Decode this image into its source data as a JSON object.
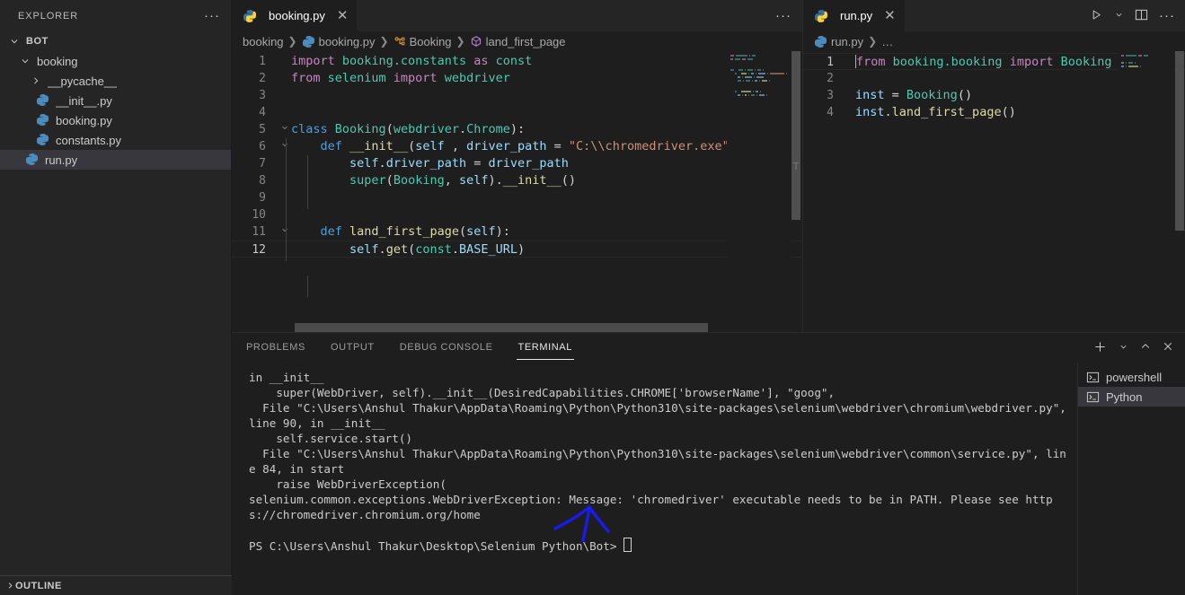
{
  "sidebar": {
    "title": "EXPLORER",
    "more_label": "···",
    "tree": [
      {
        "label": "BOT",
        "type": "folder-root",
        "expanded": true,
        "indent": 0
      },
      {
        "label": "booking",
        "type": "folder",
        "expanded": true,
        "indent": 1
      },
      {
        "label": "__pycache__",
        "type": "folder",
        "expanded": false,
        "indent": 2
      },
      {
        "label": "__init__.py",
        "type": "python",
        "indent": 2
      },
      {
        "label": "booking.py",
        "type": "python",
        "indent": 2
      },
      {
        "label": "constants.py",
        "type": "python",
        "indent": 2
      },
      {
        "label": "run.py",
        "type": "python",
        "indent": 1,
        "selected": true
      }
    ],
    "outline_label": "OUTLINE"
  },
  "editor_left": {
    "tab": {
      "title": "booking.py",
      "icon": "python-icon",
      "close": "✕"
    },
    "actions": {
      "more": "···"
    },
    "breadcrumbs": [
      {
        "label": "booking",
        "icon": "none"
      },
      {
        "label": "booking.py",
        "icon": "python-icon"
      },
      {
        "label": "Booking",
        "icon": "class-icon"
      },
      {
        "label": "land_first_page",
        "icon": "method-icon"
      }
    ],
    "separator": "❯",
    "lines": [
      {
        "n": "1",
        "tokens": [
          {
            "t": "import",
            "c": "k"
          },
          {
            "t": " booking.constants ",
            "c": "cls"
          },
          {
            "t": "as",
            "c": "k"
          },
          {
            "t": " const",
            "c": "cls"
          }
        ]
      },
      {
        "n": "2",
        "tokens": [
          {
            "t": "from",
            "c": "k"
          },
          {
            "t": " selenium ",
            "c": "cls"
          },
          {
            "t": "import",
            "c": "k"
          },
          {
            "t": " webdriver",
            "c": "cls"
          }
        ]
      },
      {
        "n": "3",
        "tokens": []
      },
      {
        "n": "4",
        "tokens": []
      },
      {
        "n": "5",
        "fold": true,
        "tokens": [
          {
            "t": "class",
            "c": "kd"
          },
          {
            "t": " ",
            "c": "pl"
          },
          {
            "t": "Booking",
            "c": "cls"
          },
          {
            "t": "(",
            "c": "pl"
          },
          {
            "t": "webdriver",
            "c": "cls"
          },
          {
            "t": ".",
            "c": "pl"
          },
          {
            "t": "Chrome",
            "c": "cls"
          },
          {
            "t": "):",
            "c": "pl"
          }
        ]
      },
      {
        "n": "6",
        "fold": true,
        "tokens": [
          {
            "t": "    ",
            "c": "pl"
          },
          {
            "t": "def",
            "c": "kd"
          },
          {
            "t": " ",
            "c": "pl"
          },
          {
            "t": "__init__",
            "c": "fn"
          },
          {
            "t": "(",
            "c": "pl"
          },
          {
            "t": "self",
            "c": "var"
          },
          {
            "t": " , ",
            "c": "pl"
          },
          {
            "t": "driver_path",
            "c": "var"
          },
          {
            "t": " = ",
            "c": "pl"
          },
          {
            "t": "\"C:\\\\chromedriver.exe\"",
            "c": "str"
          },
          {
            "t": "):",
            "c": "pl"
          }
        ]
      },
      {
        "n": "7",
        "tokens": [
          {
            "t": "        ",
            "c": "pl"
          },
          {
            "t": "self",
            "c": "var"
          },
          {
            "t": ".",
            "c": "pl"
          },
          {
            "t": "driver_path",
            "c": "var"
          },
          {
            "t": " = ",
            "c": "pl"
          },
          {
            "t": "driver_path",
            "c": "var"
          }
        ]
      },
      {
        "n": "8",
        "tokens": [
          {
            "t": "        ",
            "c": "pl"
          },
          {
            "t": "super",
            "c": "cls"
          },
          {
            "t": "(",
            "c": "pl"
          },
          {
            "t": "Booking",
            "c": "cls"
          },
          {
            "t": ", ",
            "c": "pl"
          },
          {
            "t": "self",
            "c": "var"
          },
          {
            "t": ").",
            "c": "pl"
          },
          {
            "t": "__init__",
            "c": "fn"
          },
          {
            "t": "()",
            "c": "pl"
          }
        ]
      },
      {
        "n": "9",
        "tokens": []
      },
      {
        "n": "10",
        "tokens": []
      },
      {
        "n": "11",
        "fold": true,
        "tokens": [
          {
            "t": "    ",
            "c": "pl"
          },
          {
            "t": "def",
            "c": "kd"
          },
          {
            "t": " ",
            "c": "pl"
          },
          {
            "t": "land_first_page",
            "c": "fn"
          },
          {
            "t": "(",
            "c": "pl"
          },
          {
            "t": "self",
            "c": "var"
          },
          {
            "t": "):",
            "c": "pl"
          }
        ]
      },
      {
        "n": "12",
        "current": true,
        "tokens": [
          {
            "t": "        ",
            "c": "pl"
          },
          {
            "t": "self",
            "c": "var"
          },
          {
            "t": ".",
            "c": "pl"
          },
          {
            "t": "get",
            "c": "fn"
          },
          {
            "t": "(",
            "c": "pl"
          },
          {
            "t": "const",
            "c": "cls"
          },
          {
            "t": ".",
            "c": "pl"
          },
          {
            "t": "BASE_URL",
            "c": "var"
          },
          {
            "t": ")",
            "c": "pl"
          }
        ]
      }
    ]
  },
  "editor_right": {
    "tab": {
      "title": "run.py",
      "icon": "python-icon",
      "close": "✕"
    },
    "actions": {
      "run": "run-icon",
      "run_chevron": "chevron-down-icon",
      "split": "split-editor-icon",
      "more": "···"
    },
    "breadcrumbs": [
      {
        "label": "run.py",
        "icon": "python-icon"
      },
      {
        "label": "…",
        "icon": "none"
      }
    ],
    "separator": "❯",
    "lines": [
      {
        "n": "1",
        "current": true,
        "tokens": [
          {
            "t": "from",
            "c": "k"
          },
          {
            "t": " booking.booking ",
            "c": "cls"
          },
          {
            "t": "import",
            "c": "k"
          },
          {
            "t": " Booking",
            "c": "cls"
          }
        ]
      },
      {
        "n": "2",
        "tokens": []
      },
      {
        "n": "3",
        "tokens": [
          {
            "t": "inst",
            "c": "var"
          },
          {
            "t": " = ",
            "c": "pl"
          },
          {
            "t": "Booking",
            "c": "cls"
          },
          {
            "t": "()",
            "c": "pl"
          }
        ]
      },
      {
        "n": "4",
        "tokens": [
          {
            "t": "inst",
            "c": "var"
          },
          {
            "t": ".",
            "c": "pl"
          },
          {
            "t": "land_first_page",
            "c": "fn"
          },
          {
            "t": "()",
            "c": "pl"
          }
        ]
      }
    ]
  },
  "panel": {
    "tabs": [
      {
        "label": "PROBLEMS",
        "active": false
      },
      {
        "label": "OUTPUT",
        "active": false
      },
      {
        "label": "DEBUG CONSOLE",
        "active": false
      },
      {
        "label": "TERMINAL",
        "active": true
      }
    ],
    "actions": {
      "new": "+",
      "new_chevron": "chevron-down-icon",
      "maximize": "chevron-up-icon",
      "close": "✕"
    },
    "terminal_output": "in __init__\n    super(WebDriver, self).__init__(DesiredCapabilities.CHROME['browserName'], \"goog\",\n  File \"C:\\Users\\Anshul Thakur\\AppData\\Roaming\\Python\\Python310\\site-packages\\selenium\\webdriver\\chromium\\webdriver.py\", line 90, in __init__\n    self.service.start()\n  File \"C:\\Users\\Anshul Thakur\\AppData\\Roaming\\Python\\Python310\\site-packages\\selenium\\webdriver\\common\\service.py\", line 84, in start\n    raise WebDriverException(\nselenium.common.exceptions.WebDriverException: Message: 'chromedriver' executable needs to be in PATH. Please see https://chromedriver.chromium.org/home",
    "prompt": "PS C:\\Users\\Anshul Thakur\\Desktop\\Selenium Python\\Bot> ",
    "terminal_list": [
      {
        "label": "powershell",
        "icon": "terminal-icon",
        "active": false
      },
      {
        "label": "Python",
        "icon": "terminal-icon",
        "active": true
      }
    ]
  },
  "annotation": {
    "color": "#1a1aee",
    "shape": "hand-drawn-arrow"
  }
}
